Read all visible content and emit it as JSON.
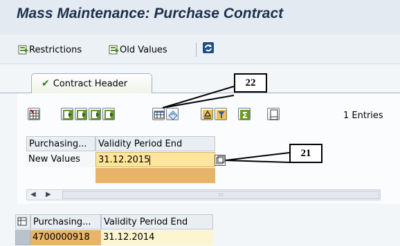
{
  "window": {
    "title": "Mass Maintenance: Purchase Contract"
  },
  "toolbar": {
    "restrictions_label": "Restrictions",
    "old_values_label": "Old Values",
    "refresh_icon": "refresh-icon"
  },
  "tabs": [
    {
      "label": "Contract Header",
      "icon": "checkmark-icon",
      "selected": true
    }
  ],
  "grid_toolbar": {
    "entries_label": "1 Entries",
    "buttons": [
      "select-all-icon",
      "column-select-icon",
      "deselect-icon",
      "block-icon",
      "find-icon",
      "select-column-icon",
      "undo-icon",
      "sort-ascending-icon",
      "filter-icon",
      "sum-icon",
      "print-icon"
    ]
  },
  "edit_table": {
    "columns": [
      "Purchasing...",
      "Validity Period End"
    ],
    "new_values_label": "New Values",
    "new_value": "31.12.2015",
    "scroll_placeholder": ":::"
  },
  "result_table": {
    "columns": [
      "Purchasing...",
      "Validity Period End"
    ],
    "rows": [
      {
        "purchasing_doc": "4700000918",
        "validity_end": "31.12.2014"
      }
    ]
  },
  "callouts": {
    "a": "22",
    "b": "21"
  },
  "colors": {
    "title": "#1c2f4b",
    "input_bg": "#fde59b",
    "input_empty": "#e8b46a",
    "result_row": "#fcf5d0"
  }
}
